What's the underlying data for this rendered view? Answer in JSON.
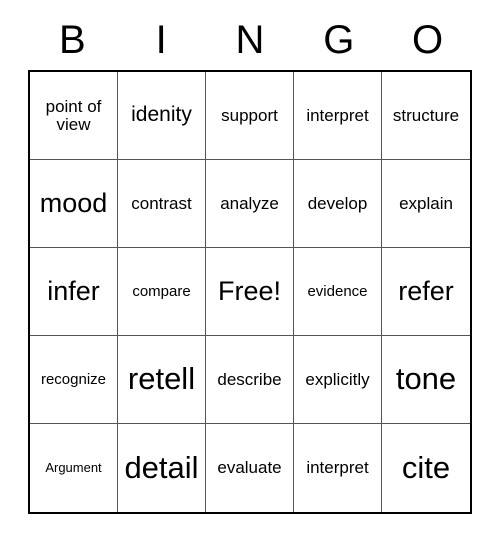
{
  "header": {
    "letters": [
      "B",
      "I",
      "N",
      "G",
      "O"
    ]
  },
  "grid": {
    "rows": [
      [
        {
          "text": "point of\nview",
          "size": "sz-m"
        },
        {
          "text": "idenity",
          "size": "sz-l"
        },
        {
          "text": "support",
          "size": "sz-m"
        },
        {
          "text": "interpret",
          "size": "sz-m"
        },
        {
          "text": "structure",
          "size": "sz-m"
        }
      ],
      [
        {
          "text": "mood",
          "size": "sz-xl"
        },
        {
          "text": "contrast",
          "size": "sz-m"
        },
        {
          "text": "analyze",
          "size": "sz-m"
        },
        {
          "text": "develop",
          "size": "sz-m"
        },
        {
          "text": "explain",
          "size": "sz-m"
        }
      ],
      [
        {
          "text": "infer",
          "size": "sz-xl"
        },
        {
          "text": "compare",
          "size": "sz-s"
        },
        {
          "text": "Free!",
          "size": "sz-xl"
        },
        {
          "text": "evidence",
          "size": "sz-s"
        },
        {
          "text": "refer",
          "size": "sz-xl"
        }
      ],
      [
        {
          "text": "recognize",
          "size": "sz-s"
        },
        {
          "text": "retell",
          "size": "sz-xxl"
        },
        {
          "text": "describe",
          "size": "sz-m"
        },
        {
          "text": "explicitly",
          "size": "sz-m"
        },
        {
          "text": "tone",
          "size": "sz-xxl"
        }
      ],
      [
        {
          "text": "Argument",
          "size": "sz-xs"
        },
        {
          "text": "detail",
          "size": "sz-xxl"
        },
        {
          "text": "evaluate",
          "size": "sz-m"
        },
        {
          "text": "interpret",
          "size": "sz-m"
        },
        {
          "text": "cite",
          "size": "sz-xxl"
        }
      ]
    ]
  },
  "colors": {
    "outer_border": "#000000",
    "inner_border": "#555555",
    "text": "#000000",
    "background": "#ffffff"
  }
}
